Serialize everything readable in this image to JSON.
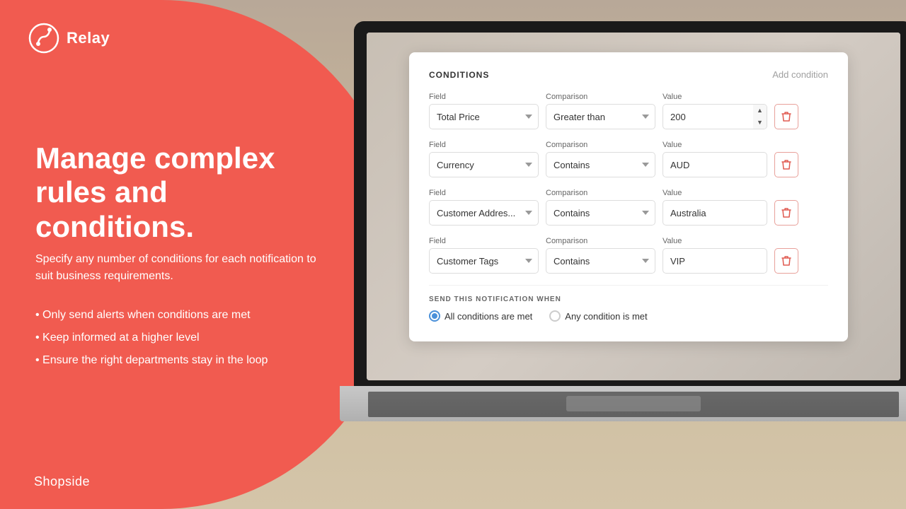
{
  "brand": {
    "logo_text": "Relay",
    "shopside_text": "Shopside"
  },
  "left_panel": {
    "headline": "Manage complex rules and conditions.",
    "subtext": "Specify any number of conditions for each notification to suit business requirements.",
    "bullets": [
      "Only send alerts when conditions are met",
      "Keep informed at a higher level",
      "Ensure the right departments stay in the loop"
    ]
  },
  "conditions": {
    "title": "CONDITIONS",
    "add_link": "Add condition",
    "field_label": "Field",
    "comparison_label": "Comparison",
    "value_label": "Value",
    "rows": [
      {
        "field": "Total Price",
        "comparison": "Greater than",
        "value": "200",
        "show_spinners": true
      },
      {
        "field": "Currency",
        "comparison": "Contains",
        "value": "AUD",
        "show_spinners": false
      },
      {
        "field": "Customer Addres...",
        "comparison": "Contains",
        "value": "Australia",
        "show_spinners": false
      },
      {
        "field": "Customer Tags",
        "comparison": "Contains",
        "value": "VIP",
        "show_spinners": false
      }
    ],
    "send_when": {
      "title": "SEND THIS NOTIFICATION WHEN",
      "options": [
        "All conditions are met",
        "Any condition is met"
      ],
      "selected": 0
    }
  }
}
